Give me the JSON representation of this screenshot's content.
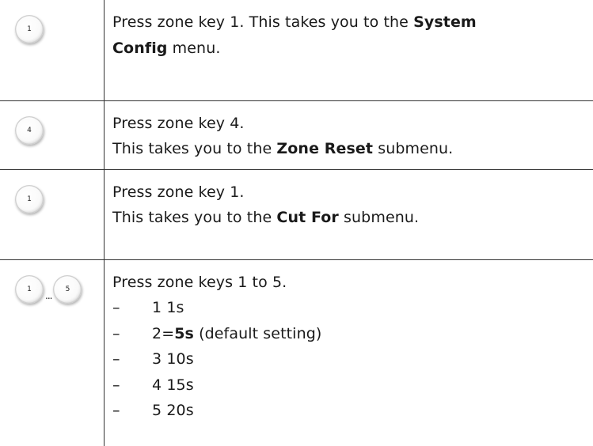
{
  "steps": [
    {
      "keys": [
        "1"
      ],
      "text_a": "Press zone key 1. This takes you to the ",
      "bold_a": "System",
      "bold_b": "Config",
      "text_b": " menu."
    },
    {
      "keys": [
        "4"
      ],
      "line1": "Press zone key 4.",
      "line2_prefix": "This takes you to the ",
      "line2_bold": "Zone Reset",
      "line2_suffix": " submenu."
    },
    {
      "keys": [
        "1"
      ],
      "line1": "Press zone key 1.",
      "line2_prefix": "This takes you to the ",
      "line2_bold": "Cut For",
      "line2_suffix": " submenu."
    },
    {
      "keys": [
        "1",
        "5"
      ],
      "ellipsis": "...",
      "line1": "Press zone keys 1 to 5.",
      "dash": "–",
      "options": [
        {
          "text": "1 1s"
        },
        {
          "prefix": "2=",
          "bold": "5s",
          "suffix": " (default setting)"
        },
        {
          "text": "3 10s"
        },
        {
          "text": "4 15s"
        },
        {
          "text": "5 20s"
        }
      ]
    }
  ]
}
